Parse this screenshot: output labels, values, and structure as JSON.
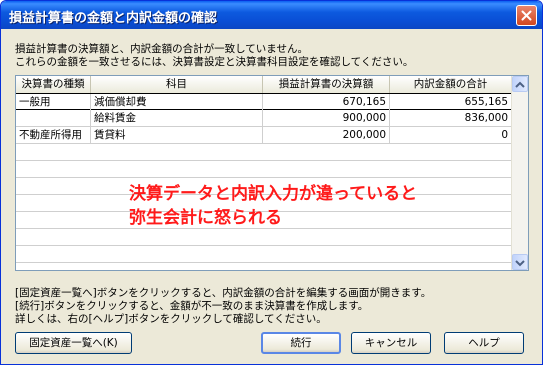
{
  "window": {
    "title": "損益計算書の金額と内訳金額の確認"
  },
  "message": {
    "line1": "損益計算書の決算額と、内訳金額の合計が一致していません。",
    "line2": "これらの金額を一致させるには、決算書設定と決算書科目設定を確認してください。"
  },
  "table": {
    "headers": [
      "決算書の種類",
      "科目",
      "損益計算書の決算額",
      "内訳金額の合計"
    ],
    "rows": [
      {
        "type": "一般用",
        "account": "減価償却費",
        "pl_amount": "670,165",
        "breakdown": "655,165"
      },
      {
        "type": "",
        "account": "給料賃金",
        "pl_amount": "900,000",
        "breakdown": "836,000"
      },
      {
        "type": "不動産所得用",
        "account": "賃貸料",
        "pl_amount": "200,000",
        "breakdown": "0"
      }
    ]
  },
  "annotation": {
    "line1": "決算データと内訳入力が違っていると",
    "line2": "弥生会計に怒られる"
  },
  "help": {
    "line1": "[固定資産一覧へ]ボタンをクリックすると、内訳金額の合計を編集する画面が開きます。",
    "line2": "[続行]ボタンをクリックすると、金額が不一致のまま決算書を作成します。",
    "line3": "詳しくは、右の[ヘルプ]ボタンをクリックして確認してください。"
  },
  "buttons": {
    "fixed_assets": "固定資産一覧へ(K)",
    "continue": "続行",
    "cancel": "キャンセル",
    "help": "ヘルプ"
  },
  "icons": [
    "close-icon",
    "scroll-up-icon",
    "scroll-down-icon"
  ]
}
